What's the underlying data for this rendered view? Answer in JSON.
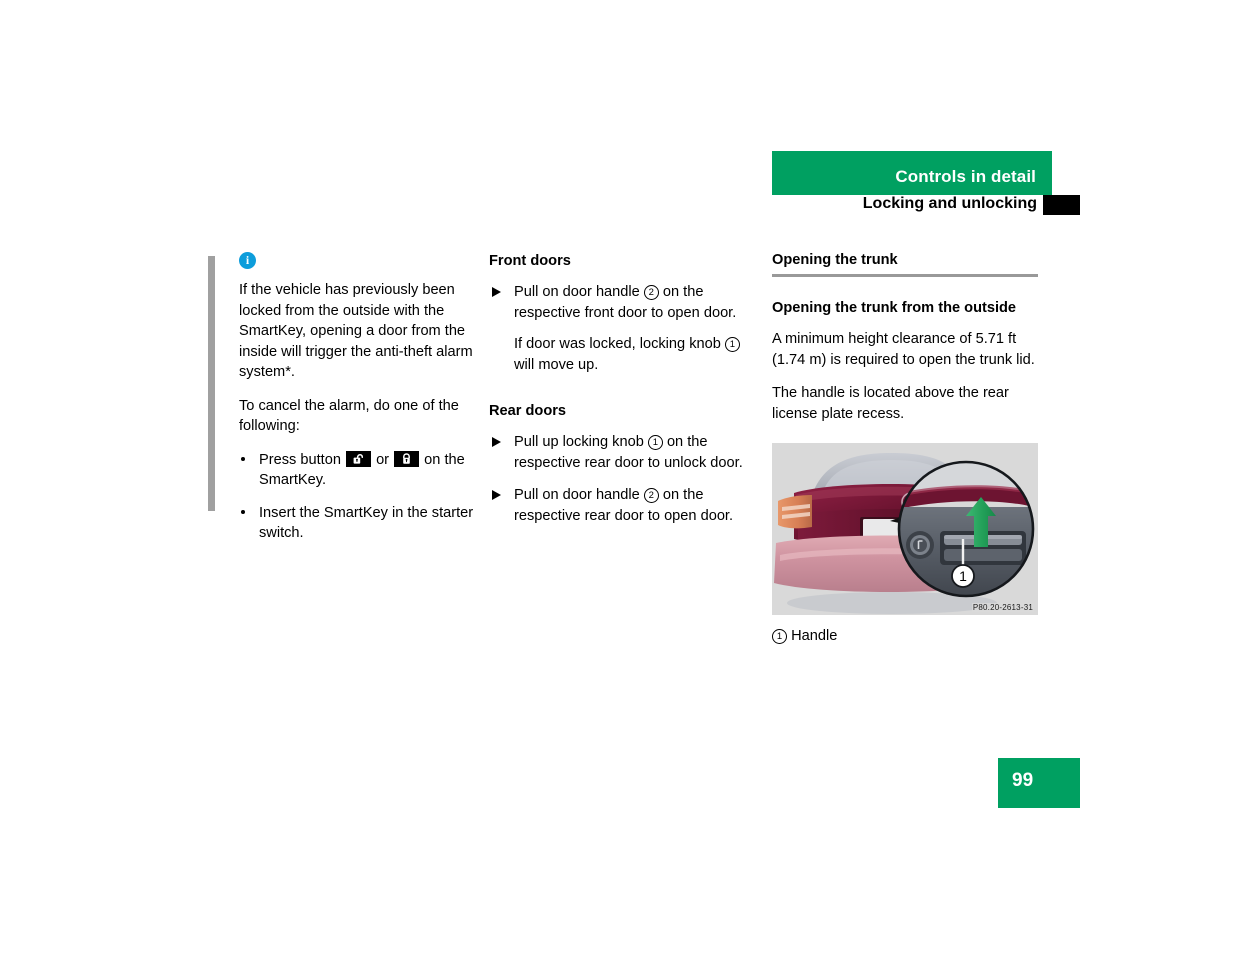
{
  "header": {
    "title": "Controls in detail",
    "subtitle": "Locking and unlocking",
    "green_color": "#00a061",
    "marker_color": "#000000"
  },
  "note": {
    "icon": "info-icon",
    "paragraph1": "If the vehicle has previously been locked from the outside with the SmartKey, opening a door from the inside will trigger the anti-theft alarm system*.",
    "paragraph2": "To cancel the alarm, do one of the following:",
    "bullets": [
      {
        "text_before": "Press button",
        "icon1": "unlock-padlock-icon",
        "text_middle": "or",
        "icon2": "lock-padlock-icon",
        "text_after": "on the SmartKey."
      },
      {
        "text": "Insert the SmartKey in the starter switch."
      }
    ]
  },
  "middle": {
    "front_doors_heading": "Front doors",
    "front_doors_step": {
      "before": "Pull on door handle",
      "marker": "2",
      "after": "on the respective front door to open door."
    },
    "front_doors_note": {
      "before": "If door was locked, locking knob",
      "marker": "1",
      "after": "will move up."
    },
    "rear_doors_heading": "Rear doors",
    "rear_doors_steps": [
      {
        "before": "Pull up locking knob",
        "marker": "1",
        "after": "on the respective rear door to unlock door."
      },
      {
        "before": "Pull on door handle",
        "marker": "2",
        "after": "on the respective rear door to open door."
      }
    ]
  },
  "right": {
    "section_heading": "Opening the trunk",
    "subsection_heading": "Opening the trunk from the outside",
    "paragraph1": "A minimum height clearance of 5.71 ft (1.74 m) is required to open the trunk lid.",
    "paragraph2": "The handle is located above the rear license plate recess.",
    "figure": {
      "id_label": "P80.20-2613-31",
      "callout_number": "1",
      "caption_marker": "1",
      "caption_text": "Handle",
      "colors": {
        "background": "#d9d9d9",
        "trunk_lid": "#6d1431",
        "rear_window": "#b9bcc4",
        "bumper": "#d39aa4",
        "taillight": "#e08a5c",
        "arrow": "#2aa45e",
        "inset_panel": "#5a6068"
      }
    }
  },
  "page_number": "99"
}
